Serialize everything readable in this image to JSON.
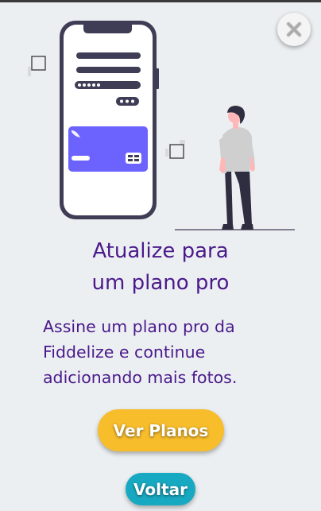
{
  "modal": {
    "title_line1": "Atualize para",
    "title_line2": "um plano pro",
    "description_line1": "Assine um plano pro da",
    "description_line2": "Fiddelize e continue",
    "description_line3": "adicionando mais fotos.",
    "primary_button_label": "Ver Planos",
    "secondary_button_label": "Voltar",
    "close_icon": "close-icon"
  },
  "colors": {
    "background": "#eceff1",
    "title": "#4a1a8c",
    "primary_button": "#f7bd2b",
    "secondary_button": "#18a9c2",
    "card": "#6c63ff",
    "phone_frame": "#3f3d56"
  }
}
